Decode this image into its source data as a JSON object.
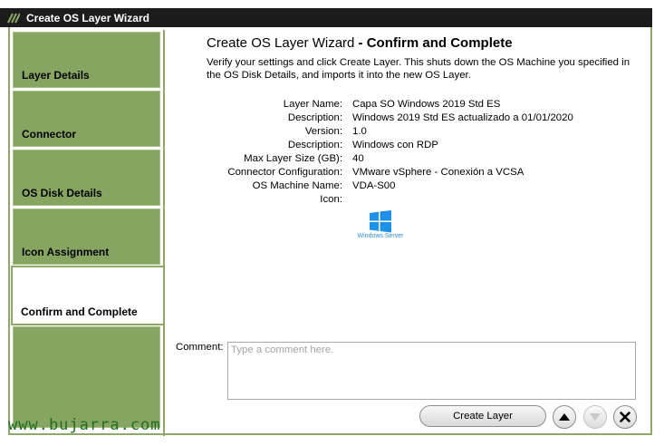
{
  "window": {
    "title": "Create OS Layer Wizard"
  },
  "nav": {
    "items": [
      {
        "label": "Layer Details"
      },
      {
        "label": "Connector"
      },
      {
        "label": "OS Disk Details"
      },
      {
        "label": "Icon Assignment"
      },
      {
        "label": "Confirm and Complete"
      }
    ],
    "active_index": 4
  },
  "main": {
    "heading_prefix": "Create OS Layer Wizard",
    "heading_step": " - Confirm and Complete",
    "description": "Verify your settings and click Create Layer. This shuts down the OS Machine you specified in the OS Disk Details, and imports it into the new OS Layer.",
    "summary": [
      {
        "label": "Layer Name:",
        "value": "Capa SO Windows 2019 Std ES"
      },
      {
        "label": "Description:",
        "value": "Windows 2019 Std ES actualizado a 01/01/2020"
      },
      {
        "label": "Version:",
        "value": "1.0"
      },
      {
        "label": "Description:",
        "value": "Windows con RDP"
      },
      {
        "label": "Max Layer Size (GB):",
        "value": "40"
      },
      {
        "label": "Connector Configuration:",
        "value": "VMware vSphere - Conexión a VCSA"
      },
      {
        "label": "OS Machine Name:",
        "value": "VDA-S00"
      },
      {
        "label": "Icon:",
        "value": ""
      }
    ],
    "icon": {
      "name": "windows-server-icon",
      "caption": "Windows Server",
      "color": "#1e90e6"
    },
    "comment": {
      "label": "Comment:",
      "placeholder": "Type a comment here.",
      "value": ""
    },
    "buttons": {
      "create_label": "Create Layer"
    }
  },
  "watermark": "www.bujarra.com",
  "colors": {
    "nav_green": "#86a560",
    "frame_green": "#8ea866",
    "titlebar": "#1c1c1c"
  }
}
